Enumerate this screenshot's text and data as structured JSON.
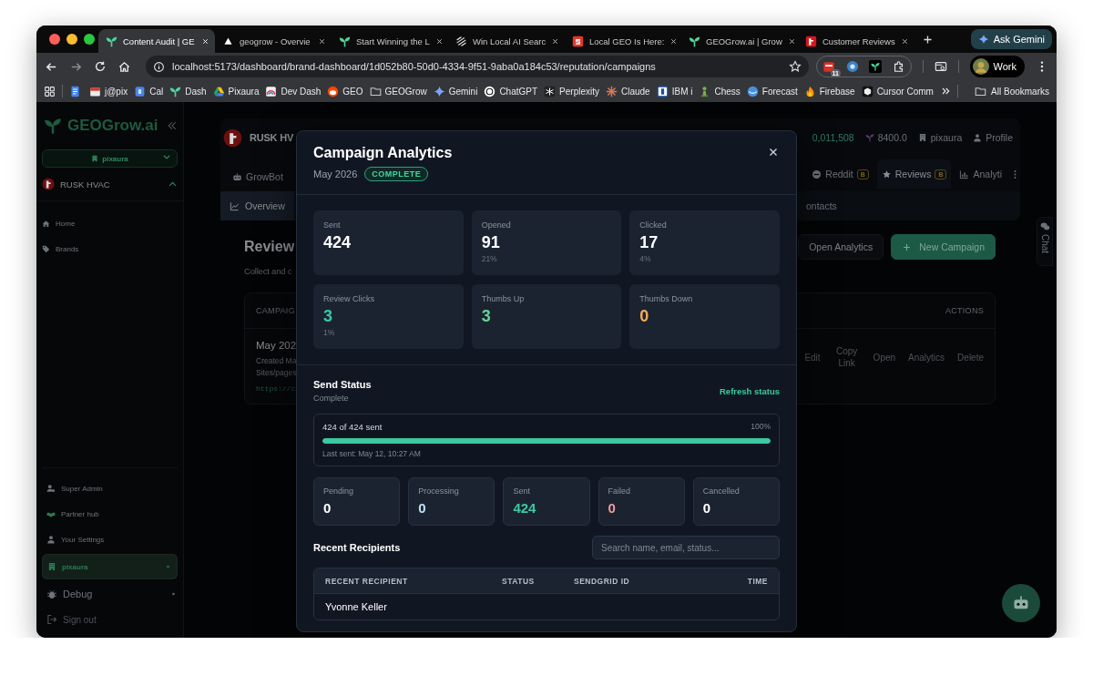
{
  "browser": {
    "tabs": [
      {
        "title": "Content Audit | GE",
        "selected": true
      },
      {
        "title": "geogrow - Overvie",
        "selected": false
      },
      {
        "title": "Start Winning the L",
        "selected": false
      },
      {
        "title": "Win Local AI Searc",
        "selected": false
      },
      {
        "title": "Local GEO Is Here:",
        "selected": false
      },
      {
        "title": "GEOGrow.ai | Grow",
        "selected": false
      },
      {
        "title": "Customer Reviews",
        "selected": false
      }
    ],
    "ask_button": "Ask Gemini",
    "url": "localhost:5173/dashboard/brand-dashboard/1d052b80-50d0-4334-9f51-9aba0a184c53/reputation/campaigns",
    "extension_badge": "11",
    "profile": "Work",
    "bookmarks": [
      "j@pix",
      "Cal",
      "Dash",
      "Pixaura",
      "Dev Dash",
      "GEO",
      "GEOGrow",
      "Gemini",
      "ChatGPT",
      "Perplexity",
      "Claude",
      "IBM i",
      "Chess",
      "Forecast",
      "Firebase",
      "Cursor Comm"
    ],
    "all_bookmarks": "All Bookmarks"
  },
  "sidebar": {
    "logo": "GEOGrow.ai",
    "org_select": "pixaura",
    "brand": {
      "name": "RUSK HVAC",
      "expanded": true
    },
    "nav": [
      {
        "label": "Home"
      },
      {
        "label": "Brands"
      }
    ],
    "footer": [
      {
        "label": "Super Admin",
        "kind": "link",
        "selected": false
      },
      {
        "label": "Partner hub",
        "kind": "link",
        "selected": false
      },
      {
        "label": "Your Settings",
        "kind": "link",
        "selected": false
      },
      {
        "label": "pixaura",
        "kind": "org",
        "selected": true
      },
      {
        "label": "Debug",
        "kind": "debug",
        "selected": false
      },
      {
        "label": "Sign out",
        "kind": "signout",
        "selected": false
      }
    ]
  },
  "main": {
    "brand": "RUSK HV",
    "stats": [
      "0,011,508",
      "8400.0",
      "pixaura",
      "Profile"
    ],
    "tabs": {
      "left": [
        {
          "label": "GrowBot",
          "selected": false
        }
      ],
      "right": [
        {
          "label": "Reddit",
          "badge": "B",
          "selected": false
        },
        {
          "label": "Reviews",
          "badge": "B",
          "selected": true
        },
        {
          "label": "Analyti",
          "selected": false
        }
      ]
    },
    "subtabs": {
      "left": [
        {
          "label": "Overview",
          "selected": true
        }
      ],
      "right": [
        {
          "label": "ontacts",
          "selected": false
        }
      ]
    },
    "page": {
      "title": "Review",
      "subtitle": "Collect and c",
      "buttons": [
        {
          "label": "Open Analytics",
          "kind": "secondary"
        },
        {
          "label": "New Campaign",
          "kind": "primary"
        }
      ]
    },
    "table": {
      "columns": [
        "CAMPAIG",
        "ACTIONS"
      ],
      "rows": [
        {
          "name": "May 202",
          "created": "Created Ma",
          "sites": "Sites/pages",
          "link": "https://c",
          "actions": [
            "Edit",
            "Copy Link",
            "Open",
            "Analytics",
            "Delete"
          ]
        }
      ]
    },
    "chat_tab": "Chat"
  },
  "modal": {
    "title": "Campaign Analytics",
    "period": "May 2026",
    "status": "COMPLETE",
    "metrics": [
      {
        "label": "Sent",
        "value": "424",
        "color": "#ffffff"
      },
      {
        "label": "Opened",
        "value": "91",
        "sub": "21%",
        "color": "#ffffff"
      },
      {
        "label": "Clicked",
        "value": "17",
        "sub": "4%",
        "color": "#ffffff"
      },
      {
        "label": "Review Clicks",
        "value": "3",
        "sub": "1%",
        "color": "#3cc9a0"
      },
      {
        "label": "Thumbs Up",
        "value": "3",
        "color": "#68d391"
      },
      {
        "label": "Thumbs Down",
        "value": "0",
        "color": "#f6ad55"
      }
    ],
    "send_status": {
      "title": "Send Status",
      "state": "Complete",
      "refresh": "Refresh status",
      "progress_text": "424 of 424 sent",
      "percent": "100%",
      "level": 1,
      "last_sent": "Last sent: May 12, 10:27 AM"
    },
    "counts": [
      {
        "label": "Pending",
        "value": "0",
        "color": "#ffffff"
      },
      {
        "label": "Processing",
        "value": "0",
        "color": "#bee3f8"
      },
      {
        "label": "Sent",
        "value": "424",
        "color": "#3cc9a0"
      },
      {
        "label": "Failed",
        "value": "0",
        "color": "#f49b9b"
      },
      {
        "label": "Cancelled",
        "value": "0",
        "color": "#ffffff"
      }
    ],
    "recipients": {
      "title": "Recent Recipients",
      "search_placeholder": "Search name, email, status...",
      "columns": [
        "RECENT RECIPIENT",
        "STATUS",
        "SENDGRID ID",
        "TIME"
      ],
      "rows": [
        {
          "name": "Yvonne Keller"
        }
      ]
    }
  }
}
